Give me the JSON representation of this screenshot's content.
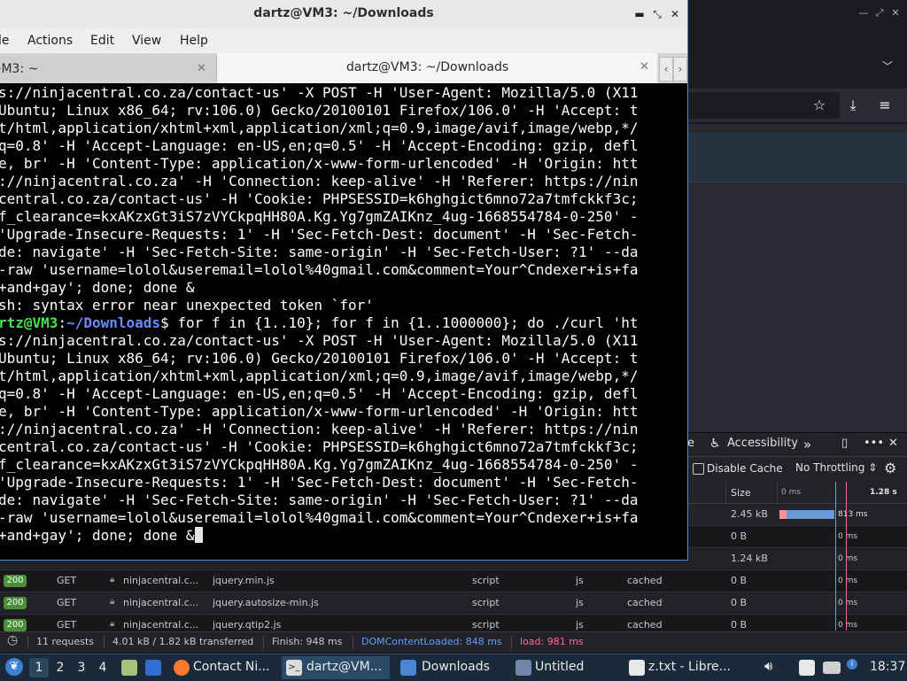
{
  "terminal": {
    "title": "dartz@VM3: ~/Downloads",
    "menu": [
      "le",
      "Actions",
      "Edit",
      "View",
      "Help"
    ],
    "tabs": [
      {
        "label": ")M3: ~",
        "active": false
      },
      {
        "label": "dartz@VM3: ~/Downloads",
        "active": true
      }
    ],
    "lines": [
      "s://ninjacentral.co.za/contact-us' -X POST -H 'User-Agent: Mozilla/5.0 (X11",
      "Ubuntu; Linux x86_64; rv:106.0) Gecko/20100101 Firefox/106.0' -H 'Accept: t",
      "t/html,application/xhtml+xml,application/xml;q=0.9,image/avif,image/webp,*/",
      "q=0.8' -H 'Accept-Language: en-US,en;q=0.5' -H 'Accept-Encoding: gzip, defl",
      "e, br' -H 'Content-Type: application/x-www-form-urlencoded' -H 'Origin: htt",
      "://ninjacentral.co.za' -H 'Connection: keep-alive' -H 'Referer: https://nin",
      "central.co.za/contact-us' -H 'Cookie: PHPSESSID=k6hghgict6mno72a7tmfckkf3c;",
      "f_clearance=kxAKzxGt3iS7zVYCkpqHH80A.Kg.Yg7gmZAIKnz_4ug-1668554784-0-250' -",
      "'Upgrade-Insecure-Requests: 1' -H 'Sec-Fetch-Dest: document' -H 'Sec-Fetch-",
      "de: navigate' -H 'Sec-Fetch-Site: same-origin' -H 'Sec-Fetch-User: ?1' --da",
      "-raw 'username=lolol&useremail=lolol%40gmail.com&comment=Your^Cndexer+is+fa",
      "+and+gay'; done; done &",
      "sh: syntax error near unexpected token `for'"
    ],
    "prompt_user": "rtz@VM3",
    "prompt_sep": ":",
    "prompt_path": "~/Downloads",
    "prompt_cmd": "$ for f in {1..10}; for f in {1..1000000}; do ./curl 'ht",
    "lines2": [
      "s://ninjacentral.co.za/contact-us' -X POST -H 'User-Agent: Mozilla/5.0 (X11",
      "Ubuntu; Linux x86_64; rv:106.0) Gecko/20100101 Firefox/106.0' -H 'Accept: t",
      "t/html,application/xhtml+xml,application/xml;q=0.9,image/avif,image/webp,*/",
      "q=0.8' -H 'Accept-Language: en-US,en;q=0.5' -H 'Accept-Encoding: gzip, defl",
      "e, br' -H 'Content-Type: application/x-www-form-urlencoded' -H 'Origin: htt",
      "://ninjacentral.co.za' -H 'Connection: keep-alive' -H 'Referer: https://nin",
      "central.co.za/contact-us' -H 'Cookie: PHPSESSID=k6hghgict6mno72a7tmfckkf3c;",
      "f_clearance=kxAKzxGt3iS7zVYCkpqHH80A.Kg.Yg7gmZAIKnz_4ug-1668554784-0-250' -",
      "'Upgrade-Insecure-Requests: 1' -H 'Sec-Fetch-Dest: document' -H 'Sec-Fetch-",
      "de: navigate' -H 'Sec-Fetch-Site: same-origin' -H 'Sec-Fetch-User: ?1' --da",
      "-raw 'username=lolol&useremail=lolol%40gmail.com&comment=Your^Cndexer+is+fa"
    ],
    "last_line": "+and+gay'; done; done &"
  },
  "devtools": {
    "tabs": [
      "e",
      "Accessibility"
    ],
    "disable_cache_label": "Disable Cache",
    "throttling": "No Throttling ⇕",
    "columns": {
      "size": "Size",
      "wf_start": "0 ms",
      "wf_end": "1.28 s"
    },
    "rows": [
      {
        "status": "",
        "method": "",
        "domain": "",
        "file": "",
        "type": "",
        "ext": "",
        "transferred": "",
        "size": "2.45 kB",
        "timing": "813 ms"
      },
      {
        "status": "",
        "method": "",
        "domain": "",
        "file": "",
        "type": "",
        "ext": "",
        "transferred": "",
        "size": "0 B",
        "timing": "0 ms"
      },
      {
        "status": "",
        "method": "",
        "domain": "",
        "file": "",
        "type": "",
        "ext": "",
        "transferred": "",
        "size": "1.24 kB",
        "timing": "0 ms"
      },
      {
        "status": "200",
        "method": "GET",
        "domain": "ninjacentral.c...",
        "file": "jquery.min.js",
        "type": "script",
        "ext": "js",
        "transferred": "cached",
        "size": "0 B",
        "timing": "0 ms"
      },
      {
        "status": "200",
        "method": "GET",
        "domain": "ninjacentral.c...",
        "file": "jquery.autosize-min.js",
        "type": "script",
        "ext": "js",
        "transferred": "cached",
        "size": "0 B",
        "timing": "0 ms"
      },
      {
        "status": "200",
        "method": "GET",
        "domain": "ninjacentral.c...",
        "file": "jquery.qtip2.js",
        "type": "script",
        "ext": "js",
        "transferred": "cached",
        "size": "0 B",
        "timing": "0 ms"
      }
    ],
    "status_bar": {
      "requests": "11 requests",
      "transferred": "4.01 kB / 1.82 kB transferred",
      "finish": "Finish: 948 ms",
      "dom_loaded": "DOMContentLoaded: 848 ms",
      "load": "load: 981 ms"
    }
  },
  "taskbar": {
    "workspaces": [
      "1",
      "2",
      "3",
      "4"
    ],
    "apps": [
      {
        "label": "Contact Ni..."
      },
      {
        "label": "dartz@VM..."
      },
      {
        "label": "Downloads"
      },
      {
        "label": "Untitled"
      },
      {
        "label": "z.txt - Libre..."
      }
    ],
    "clock": "18:37"
  },
  "colors": {
    "prompt_user": "#4ee04e",
    "prompt_path": "#6b8cff",
    "status_ok": "#4b8f3b",
    "dom_loaded": "#5ca0ff",
    "load": "#ff6a9a"
  }
}
